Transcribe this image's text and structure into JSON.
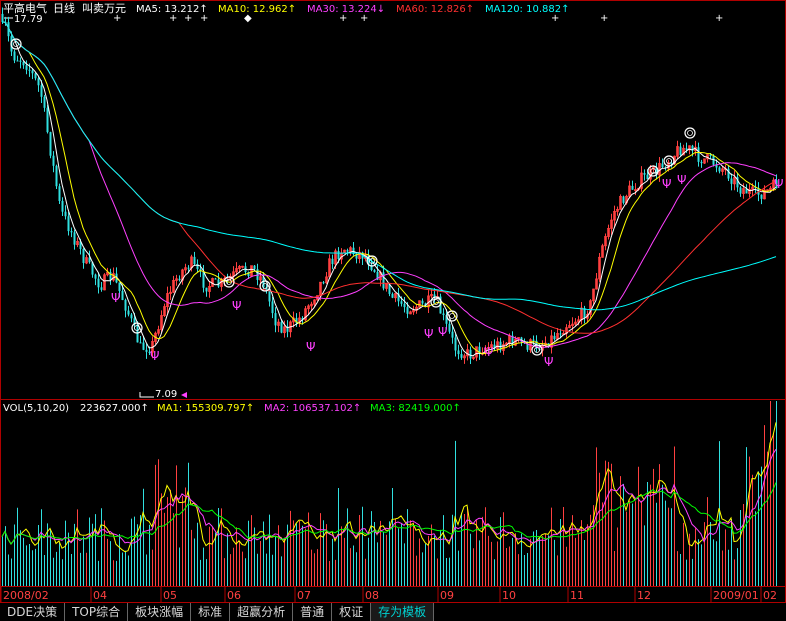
{
  "header": {
    "stock_name": "平高电气",
    "period": "日线",
    "view_mode": "叫卖万元",
    "ma_items": [
      {
        "label": "MA5: 13.212↑",
        "color": "#ffffff"
      },
      {
        "label": "MA10: 12.962↑",
        "color": "#ffff00"
      },
      {
        "label": "MA30: 13.224↓",
        "color": "#ff40ff"
      },
      {
        "label": "MA60: 12.826↑",
        "color": "#ff3030"
      },
      {
        "label": "MA120: 10.882↑",
        "color": "#00ffff"
      }
    ]
  },
  "volume_header": {
    "indicator": "VOL(5,10,20)",
    "items": [
      {
        "label": "223627.000↑",
        "color": "#ffffff"
      },
      {
        "label": "MA1: 155309.797↑",
        "color": "#ffff00"
      },
      {
        "label": "MA2: 106537.102↑",
        "color": "#ff40ff"
      },
      {
        "label": "MA3: 82419.000↑",
        "color": "#00ff00"
      }
    ]
  },
  "chart_data": {
    "type": "table",
    "price_axis": {
      "max_label": "17.79",
      "min_label": "7.09"
    },
    "x_labels": [
      "2008/02",
      "04",
      "05",
      "06",
      "07",
      "08",
      "09",
      "10",
      "11",
      "12",
      "2009/01",
      "02"
    ]
  },
  "tabs": [
    {
      "label": "DDE决策",
      "active": false
    },
    {
      "label": "TOP综合",
      "active": false
    },
    {
      "label": "板块涨幅",
      "active": false
    },
    {
      "label": "标准",
      "active": false
    },
    {
      "label": "超赢分析",
      "active": false
    },
    {
      "label": "普通",
      "active": false
    },
    {
      "label": "权证",
      "active": false
    },
    {
      "label": "存为模板",
      "active": true
    }
  ]
}
